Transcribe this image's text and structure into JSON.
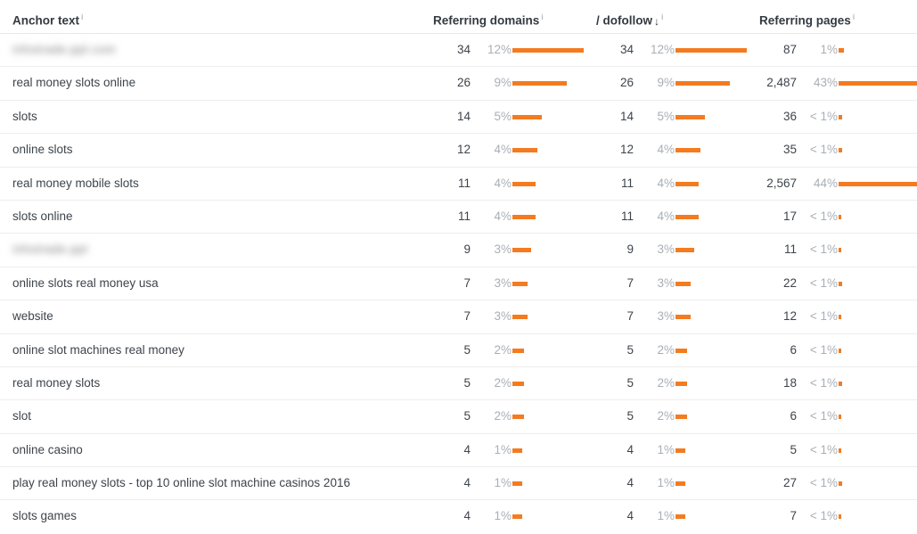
{
  "table": {
    "columns": [
      {
        "key": "anchor",
        "label": "Anchor text",
        "info": "i",
        "sorted": false
      },
      {
        "key": "rdomains",
        "label": "Referring domains",
        "info": "i",
        "sorted": false
      },
      {
        "key": "dofollow",
        "label": "/ dofollow",
        "info": "i",
        "sorted": true,
        "sort_arrow": "↓"
      },
      {
        "key": "rpages",
        "label": "Referring pages",
        "info": "i",
        "sorted": false
      }
    ],
    "bar_color": "#f47b20",
    "max_bar_width": 90,
    "rows": [
      {
        "anchor": "inhotrade.ppl.com",
        "redacted": true,
        "redacted_width": 131,
        "rdomains_count": "34",
        "rdomains_pct": "12%",
        "rdomains_bar": 80,
        "dofollow_count": "34",
        "dofollow_pct": "12%",
        "dofollow_bar": 80,
        "rpages_count": "87",
        "rpages_pct": "1%",
        "rpages_bar": 6
      },
      {
        "anchor": "real money slots online",
        "redacted": false,
        "rdomains_count": "26",
        "rdomains_pct": "9%",
        "rdomains_bar": 61,
        "dofollow_count": "26",
        "dofollow_pct": "9%",
        "dofollow_bar": 61,
        "rpages_count": "2,487",
        "rpages_pct": "43%",
        "rpages_bar": 88
      },
      {
        "anchor": "slots",
        "redacted": false,
        "rdomains_count": "14",
        "rdomains_pct": "5%",
        "rdomains_bar": 33,
        "dofollow_count": "14",
        "dofollow_pct": "5%",
        "dofollow_bar": 33,
        "rpages_count": "36",
        "rpages_pct": "< 1%",
        "rpages_bar": 4
      },
      {
        "anchor": "online slots",
        "redacted": false,
        "rdomains_count": "12",
        "rdomains_pct": "4%",
        "rdomains_bar": 28,
        "dofollow_count": "12",
        "dofollow_pct": "4%",
        "dofollow_bar": 28,
        "rpages_count": "35",
        "rpages_pct": "< 1%",
        "rpages_bar": 4
      },
      {
        "anchor": "real money mobile slots",
        "redacted": false,
        "rdomains_count": "11",
        "rdomains_pct": "4%",
        "rdomains_bar": 26,
        "dofollow_count": "11",
        "dofollow_pct": "4%",
        "dofollow_bar": 26,
        "rpages_count": "2,567",
        "rpages_pct": "44%",
        "rpages_bar": 90
      },
      {
        "anchor": "slots online",
        "redacted": false,
        "rdomains_count": "11",
        "rdomains_pct": "4%",
        "rdomains_bar": 26,
        "dofollow_count": "11",
        "dofollow_pct": "4%",
        "dofollow_bar": 26,
        "rpages_count": "17",
        "rpages_pct": "< 1%",
        "rpages_bar": 3
      },
      {
        "anchor": "inhotrade.ppl",
        "redacted": true,
        "redacted_width": 96,
        "rdomains_count": "9",
        "rdomains_pct": "3%",
        "rdomains_bar": 21,
        "dofollow_count": "9",
        "dofollow_pct": "3%",
        "dofollow_bar": 21,
        "rpages_count": "11",
        "rpages_pct": "< 1%",
        "rpages_bar": 3
      },
      {
        "anchor": "online slots real money usa",
        "redacted": false,
        "rdomains_count": "7",
        "rdomains_pct": "3%",
        "rdomains_bar": 17,
        "dofollow_count": "7",
        "dofollow_pct": "3%",
        "dofollow_bar": 17,
        "rpages_count": "22",
        "rpages_pct": "< 1%",
        "rpages_bar": 4
      },
      {
        "anchor": "website",
        "redacted": false,
        "rdomains_count": "7",
        "rdomains_pct": "3%",
        "rdomains_bar": 17,
        "dofollow_count": "7",
        "dofollow_pct": "3%",
        "dofollow_bar": 17,
        "rpages_count": "12",
        "rpages_pct": "< 1%",
        "rpages_bar": 3
      },
      {
        "anchor": "online slot machines real money",
        "redacted": false,
        "rdomains_count": "5",
        "rdomains_pct": "2%",
        "rdomains_bar": 13,
        "dofollow_count": "5",
        "dofollow_pct": "2%",
        "dofollow_bar": 13,
        "rpages_count": "6",
        "rpages_pct": "< 1%",
        "rpages_bar": 3
      },
      {
        "anchor": "real money slots",
        "redacted": false,
        "rdomains_count": "5",
        "rdomains_pct": "2%",
        "rdomains_bar": 13,
        "dofollow_count": "5",
        "dofollow_pct": "2%",
        "dofollow_bar": 13,
        "rpages_count": "18",
        "rpages_pct": "< 1%",
        "rpages_bar": 4
      },
      {
        "anchor": "slot",
        "redacted": false,
        "rdomains_count": "5",
        "rdomains_pct": "2%",
        "rdomains_bar": 13,
        "dofollow_count": "5",
        "dofollow_pct": "2%",
        "dofollow_bar": 13,
        "rpages_count": "6",
        "rpages_pct": "< 1%",
        "rpages_bar": 3
      },
      {
        "anchor": "online casino",
        "redacted": false,
        "rdomains_count": "4",
        "rdomains_pct": "1%",
        "rdomains_bar": 11,
        "dofollow_count": "4",
        "dofollow_pct": "1%",
        "dofollow_bar": 11,
        "rpages_count": "5",
        "rpages_pct": "< 1%",
        "rpages_bar": 3
      },
      {
        "anchor": "play real money slots - top 10 online slot machine casinos 2016",
        "redacted": false,
        "rdomains_count": "4",
        "rdomains_pct": "1%",
        "rdomains_bar": 11,
        "dofollow_count": "4",
        "dofollow_pct": "1%",
        "dofollow_bar": 11,
        "rpages_count": "27",
        "rpages_pct": "< 1%",
        "rpages_bar": 4
      },
      {
        "anchor": "slots games",
        "redacted": false,
        "rdomains_count": "4",
        "rdomains_pct": "1%",
        "rdomains_bar": 11,
        "dofollow_count": "4",
        "dofollow_pct": "1%",
        "dofollow_bar": 11,
        "rpages_count": "7",
        "rpages_pct": "< 1%",
        "rpages_bar": 3
      }
    ]
  }
}
